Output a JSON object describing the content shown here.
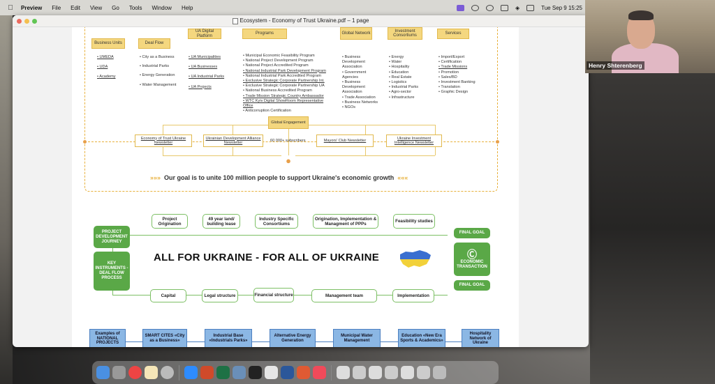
{
  "menubar": {
    "app": "Preview",
    "items": [
      "File",
      "Edit",
      "View",
      "Go",
      "Tools",
      "Window",
      "Help"
    ],
    "clock": "Tue Sep 9  15:25"
  },
  "window": {
    "title": "Ecosystem - Economy of Trust Ukraine.pdf – 1 page"
  },
  "network": {
    "columns": [
      {
        "head": "Business Units",
        "items": [
          "UMEDA",
          "UDA",
          "Academy"
        ],
        "underlined": true
      },
      {
        "head": "Deal Flow",
        "items": [
          "City as a Business",
          "Industrial Parks",
          "Energy Generation",
          "Water Management"
        ],
        "underlined": false
      },
      {
        "head": "UA Digital Platform",
        "items": [
          "UA Municipalities",
          "UA Businesses",
          "UA Industrial Parks",
          "UA Projects"
        ],
        "underlined": true
      },
      {
        "head": "Programs",
        "items": [
          "Municipal Economic Feasibility Program",
          "National Project Development Program",
          "National Project Accredited Program",
          "National Industrial Park Development Program",
          "National Industrial Park Accredited Program",
          "Exclusive Strategic Corporate Partnership Int.",
          "Exclusive Strategic Corporate Partnership UA",
          "National Business Accredited Program",
          "Trade Mission Strategic Country Ambassador",
          "WTC Kyiv Digital ShowRoom Representative Office",
          "Anticorruption Certification"
        ],
        "underlined": false
      },
      {
        "head": "Global Network",
        "items": [
          "Business Development Association",
          "Government Agencies",
          "Business Development Association",
          "Trade Association",
          "Business Networks",
          "NGOs"
        ],
        "underlined": false
      },
      {
        "head": "Investment Consortiums",
        "items": [
          "Energy",
          "Water",
          "Hospitality",
          "Education",
          "Real Estate",
          "Logistics",
          "Industrial Parks",
          "Agro-sector",
          "Infrastructure"
        ],
        "underlined": false
      },
      {
        "head": "Services",
        "items": [
          "Import/Export",
          "Certification",
          "Trade Missions",
          "Promotion",
          "Sales/BD",
          "Investment Banking",
          "Translation",
          "Graphic Design"
        ],
        "underlined": false
      }
    ],
    "global_engagement": "Global Engagement",
    "newsletters": [
      "Economy of Trust Ukraine Newsletter",
      "Ukrainian Development Alliance Newsletter",
      "Mayors' Club Newsletter",
      "Ukraine Investment Intelligence Newsletter"
    ],
    "subscribers": "60 000+ subscribers",
    "goal": "Our goal is to unite 100 million people to support Ukraine's economic growth",
    "chev_left": "»»»",
    "chev_right": "«««"
  },
  "journey": {
    "left_top": "PROJECT DEVELOPMENT JOURNEY",
    "left_bottom": "KEY INSTRUMENTS - DEAL FLOW PROCESS",
    "top_row": [
      "Project Origination",
      "49 year land/ building lease",
      "Industry Specific Consortiums",
      "Origination, Implementation & Managment of PPPs",
      "Feasibility studies"
    ],
    "bottom_row": [
      "Capital",
      "Legal structure",
      "Financial structure",
      "Management team",
      "Implementation"
    ],
    "final_goal": "FINAL GOAL",
    "final_goal_2": "FINAL GOAL",
    "economic_transaction": "ECONOMIC TRANSACTION",
    "slogan": "ALL FOR UKRAINE - FOR ALL OF UKRAINE"
  },
  "projects": [
    "Examples of NATIONAL PROJECTS",
    "SMART CITES «City as a Business»",
    "Industrial Base «Industrials Parks»",
    "Alternative Energy Generation",
    "Municipal Water Management",
    "Education «New Era Sports & Academics»",
    "Hospitality Network of Ukraine"
  ],
  "webcam": {
    "name": "Henry Shterenberg"
  },
  "colors": {
    "yellow": "#f4d77f",
    "green": "#5aa847",
    "blue": "#8bb7e4",
    "flag_blue": "#3a6fd0",
    "flag_yellow": "#f2d13a"
  }
}
